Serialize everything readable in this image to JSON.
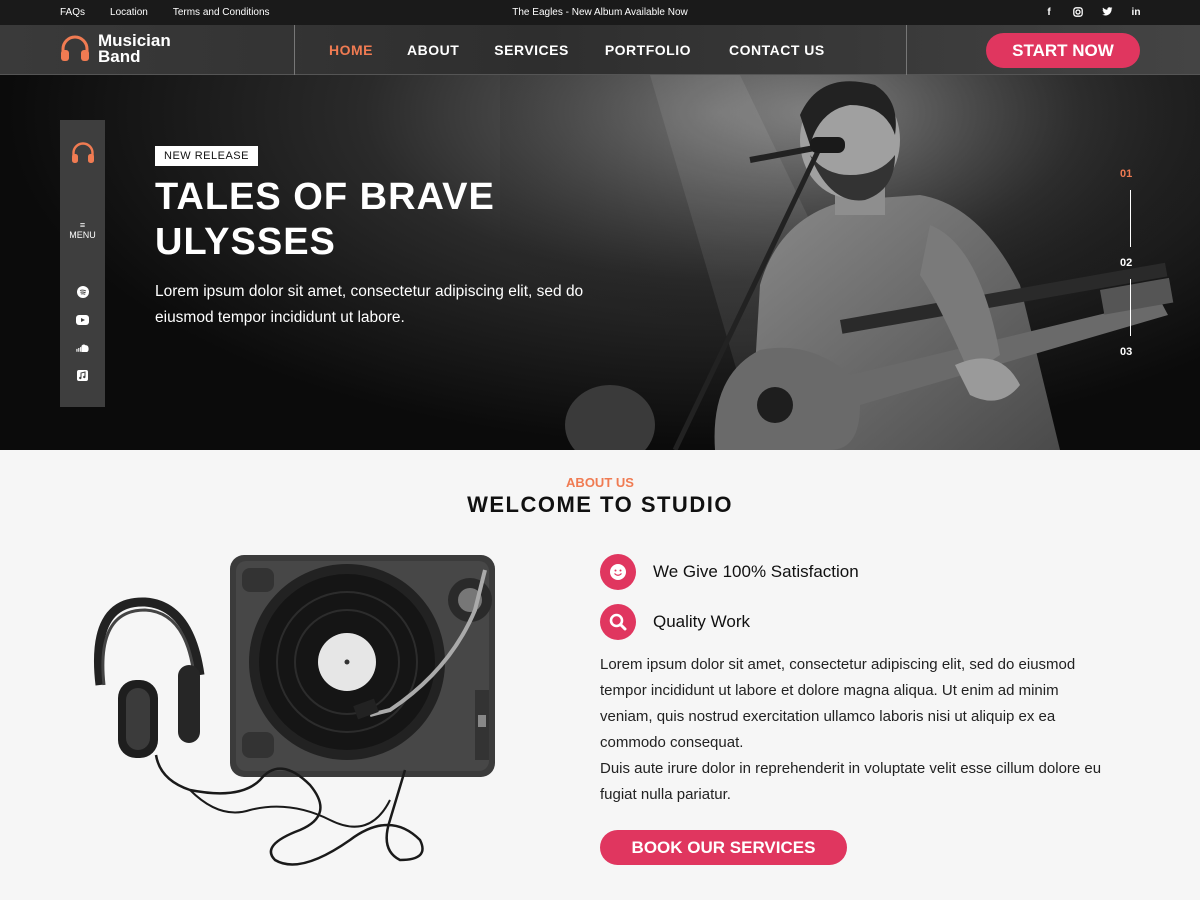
{
  "topbar": {
    "links": [
      "FAQs",
      "Location",
      "Terms and Conditions"
    ],
    "announcement": "The Eagles - New Album Available Now",
    "social": [
      "facebook-icon",
      "instagram-icon",
      "twitter-icon",
      "linkedin-icon"
    ]
  },
  "header": {
    "logo_line1": "Musician",
    "logo_line2": "Band",
    "nav": [
      "HOME",
      "ABOUT",
      "SERVICES",
      "PORTFOLIO",
      "CONTACT US"
    ],
    "active_nav": "HOME",
    "cta": "START NOW"
  },
  "side_menu": {
    "menu_label": "MENU",
    "icons": [
      "headphones-icon",
      "menu-icon",
      "spotify-icon",
      "youtube-icon",
      "soundcloud-icon",
      "music-app-icon"
    ]
  },
  "hero": {
    "badge": "NEW RELEASE",
    "title_line1": "TALES OF BRAVE",
    "title_line2": "ULYSSES",
    "description_line1": "Lorem ipsum dolor sit amet, consectetur adipiscing elit, sed do",
    "description_line2": "eiusmod tempor incididunt ut labore.",
    "slides": [
      "01",
      "02",
      "03"
    ],
    "active_slide": "01"
  },
  "about": {
    "subtitle": "ABOUT US",
    "title": "WELCOME TO STUDIO",
    "features": [
      {
        "icon": "smiley-icon",
        "label": "We Give 100% Satisfaction"
      },
      {
        "icon": "search-icon",
        "label": "Quality Work"
      }
    ],
    "paragraph_line1": "Lorem ipsum dolor sit amet, consectetur adipiscing elit, sed do eiusmod",
    "paragraph_line2": "tempor incididunt ut labore et dolore magna aliqua. Ut enim ad minim",
    "paragraph_line3": "veniam, quis nostrud exercitation ullamco laboris nisi ut aliquip ex ea",
    "paragraph_line4": "commodo consequat.",
    "paragraph_line5": "Duis aute irure dolor in reprehenderit in voluptate velit esse cillum dolore eu",
    "paragraph_line6": "fugiat nulla pariatur.",
    "button": "BOOK OUR SERVICES"
  },
  "colors": {
    "accent_orange": "#f07b52",
    "accent_pink": "#e0365f",
    "dark": "#1a1a1a"
  }
}
